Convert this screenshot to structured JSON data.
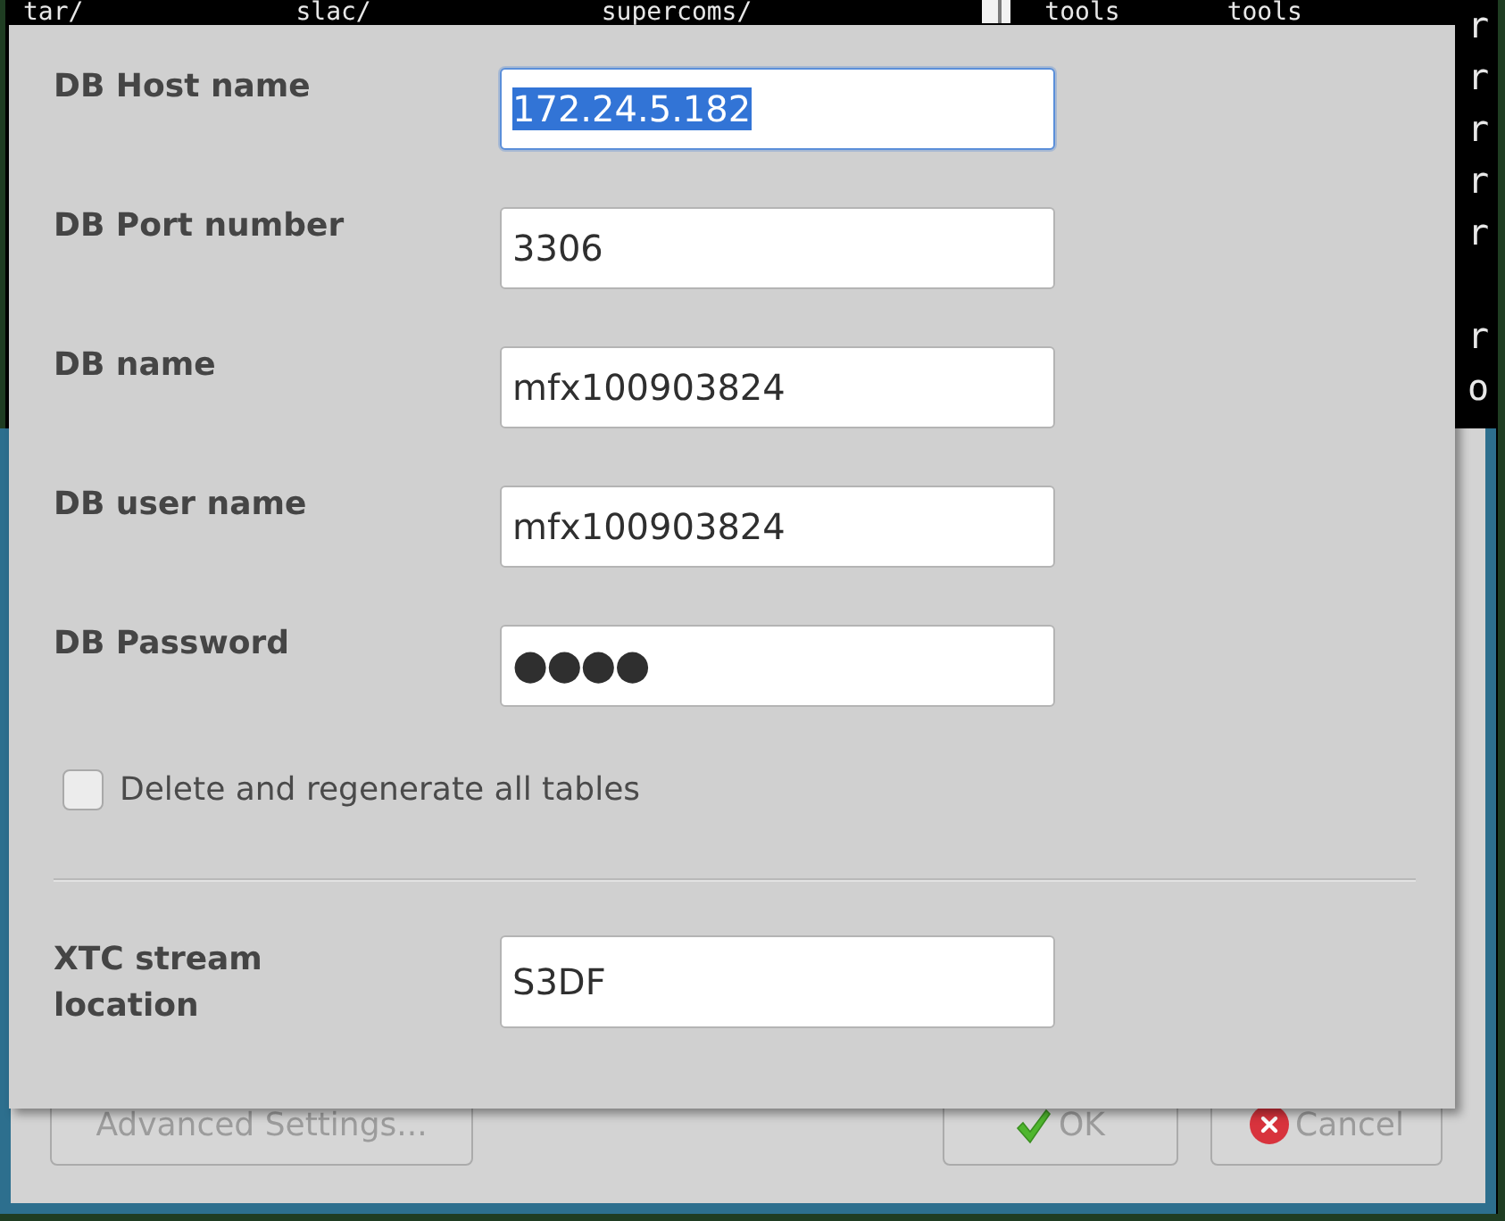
{
  "terminal": {
    "top_row": [
      "tar/",
      "slac/",
      "supercoms/",
      "tools",
      "tools"
    ],
    "right_column": [
      [
        "r",
        "r",
        "r",
        "r",
        "r"
      ],
      [
        "r",
        "o"
      ]
    ]
  },
  "dialog": {
    "fields": [
      {
        "label": "DB Host name",
        "value": "172.24.5.182",
        "kind": "text",
        "focused": true,
        "text_selected": true
      },
      {
        "label": "DB Port number",
        "value": "3306",
        "kind": "text",
        "focused": false,
        "text_selected": false
      },
      {
        "label": "DB name",
        "value": "mfx100903824",
        "kind": "text",
        "focused": false,
        "text_selected": false
      },
      {
        "label": "DB user name",
        "value": "mfx100903824",
        "kind": "text",
        "focused": false,
        "text_selected": false
      },
      {
        "label": "DB Password",
        "value": "●●●●",
        "kind": "password",
        "focused": false,
        "text_selected": false
      }
    ],
    "checkbox": {
      "label": "Delete and regenerate all tables",
      "checked": false
    },
    "stream_field": {
      "label": "XTC stream location",
      "value": "S3DF",
      "focused": false,
      "text_selected": false
    }
  },
  "main_window": {
    "buttons": [
      {
        "label": "Advanced Settings...",
        "kind": "settings",
        "disabled": true
      },
      {
        "label": "OK",
        "kind": "ok",
        "disabled": true
      },
      {
        "label": "Cancel",
        "kind": "cancel",
        "disabled": true
      }
    ]
  }
}
